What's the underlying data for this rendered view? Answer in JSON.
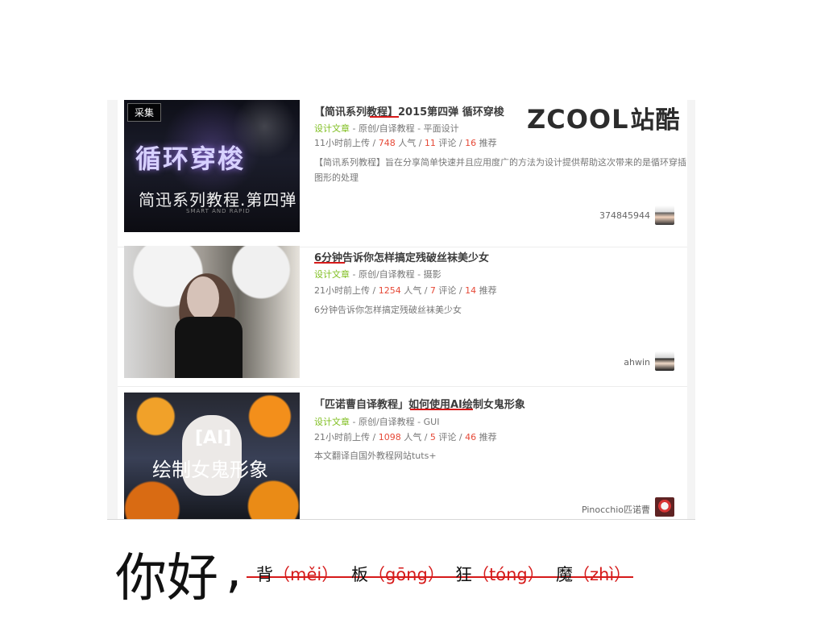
{
  "site_logo": {
    "latin": "ZCOOL",
    "cn": "站酷"
  },
  "items": [
    {
      "badge": "采集",
      "thumb_title": "循环穿梭",
      "thumb_sub": "简迅系列教程.第四弹",
      "thumb_small": "SMART AND RAPID",
      "title": "【简讯系列教程】2015第四弹 循环穿梭",
      "meta_category": "设计文章",
      "meta_rest": " - 原创/自译教程 - 平面设计",
      "time": "11小时前上传 / ",
      "views": "748",
      "views_label": " 人气 / ",
      "comments": "11",
      "comments_label": " 评论 / ",
      "recommends": "16",
      "recommends_label": " 推荐",
      "description_line1": "【简讯系列教程】旨在分享简单快速并且应用度广的方法为设计提供帮助这次带来的是循环穿插",
      "description_line2": "图形的处理",
      "author": "374845944"
    },
    {
      "title": "6分钟告诉你怎样搞定残破丝袜美少女",
      "meta_category": "设计文章",
      "meta_rest": " - 原创/自译教程 - 摄影",
      "time": "21小时前上传 / ",
      "views": "1254",
      "views_label": " 人气 / ",
      "comments": "7",
      "comments_label": " 评论 / ",
      "recommends": "14",
      "recommends_label": " 推荐",
      "description_line1": "6分钟告诉你怎样搞定残破丝袜美少女",
      "author": "ahwin"
    },
    {
      "thumb_title": "[AI]",
      "thumb_sub": "绘制女鬼形象",
      "title": "「匹诺曹自译教程」如何使用AI绘制女鬼形象",
      "meta_category": "设计文章",
      "meta_rest": " - 原创/自译教程 - GUI",
      "time": "21小时前上传 / ",
      "views": "1098",
      "views_label": " 人气 / ",
      "comments": "5",
      "comments_label": " 评论 / ",
      "recommends": "46",
      "recommends_label": " 推荐",
      "description_line1": "本文翻译自国外教程网站tuts+",
      "author": "Pinocchio匹诺曹"
    }
  ],
  "footer": {
    "hello": "你好",
    "comma": ",",
    "char1": "背",
    "pinyin1": "（měi）",
    "char2": "板",
    "pinyin2": "（gōng）",
    "char3": "狂",
    "pinyin3": "（tóng）",
    "char4": "魔",
    "pinyin4": "（zhì）"
  },
  "colors": {
    "green": "#7fbe1f",
    "red": "#e64937",
    "underline_red": "#d61a1a"
  }
}
